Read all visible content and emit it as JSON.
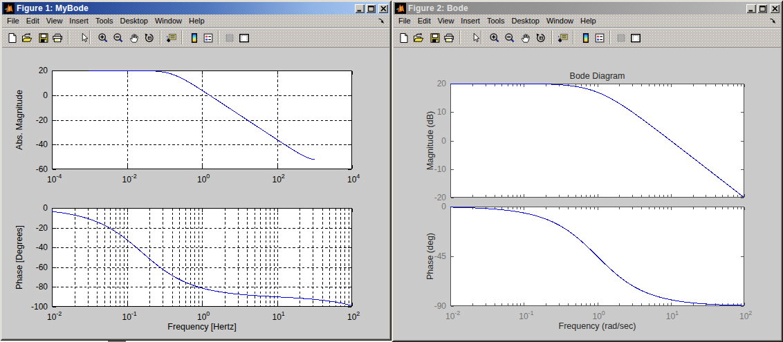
{
  "windows": [
    {
      "title": "Figure 1: MyBode",
      "state": "active",
      "menu": [
        "File",
        "Edit",
        "View",
        "Insert",
        "Tools",
        "Desktop",
        "Window",
        "Help"
      ],
      "toolbar": [
        "new-figure",
        "open-file",
        "save-figure",
        "print-figure",
        "edit-plot",
        "zoom-in",
        "zoom-out",
        "pan",
        "rotate-3d",
        "data-cursor",
        "insert-colorbar",
        "insert-legend",
        "hide-plot-tools",
        "show-plot-tools"
      ]
    },
    {
      "title": "Figure 2: Bode",
      "state": "inactive",
      "menu": [
        "File",
        "Edit",
        "View",
        "Insert",
        "Tools",
        "Desktop",
        "Window",
        "Help"
      ],
      "toolbar": [
        "new-figure",
        "open-file",
        "save-figure",
        "print-figure",
        "edit-plot",
        "zoom-in",
        "zoom-out",
        "pan",
        "rotate-3d",
        "data-cursor",
        "insert-colorbar",
        "insert-legend",
        "hide-plot-tools",
        "show-plot-tools"
      ]
    }
  ],
  "colors": {
    "curve": "#0000dd",
    "titlebar_active_start": "#0a246a",
    "titlebar_active_end": "#a6caf0",
    "titlebar_inactive_start": "#7f7f7f",
    "titlebar_inactive_end": "#c3c3c3",
    "chrome": "#c7c4bc",
    "figure_background": "#c9c9c9",
    "axes_black": "#000000",
    "axes_gray": "#4c4c4c",
    "tick_label_gray": "#757575"
  },
  "chart_data": [
    {
      "id": "fig1-magnitude",
      "type": "line",
      "figure": "Figure 1: MyBode",
      "xscale": "log",
      "xlim": [
        0.0001,
        10000.0
      ],
      "ylim": [
        -60,
        20
      ],
      "xtick_exponents": [
        -4,
        -2,
        0,
        2,
        4
      ],
      "yticks": [
        20,
        0,
        -20,
        -40,
        -60
      ],
      "xlabel": "",
      "ylabel": "Abs. Magnitude",
      "title": "",
      "grid": true,
      "x_minor_grid": false,
      "legend": null,
      "series": [
        {
          "name": "magnitude-db",
          "x": [
            0.001,
            0.00125893,
            0.00158489,
            0.00199526,
            0.00251189,
            0.00316228,
            0.00398107,
            0.00501187,
            0.00630957,
            0.00794328,
            0.01,
            0.0125893,
            0.0158489,
            0.0199526,
            0.0251189,
            0.0316228,
            0.0398107,
            0.0501187,
            0.0630957,
            0.0794328,
            0.1,
            0.125893,
            0.158489,
            0.199526,
            0.251189,
            0.316228,
            0.398107,
            0.501187,
            0.630957,
            0.794328,
            1.0,
            1.25893,
            1.58489,
            1.99526,
            2.51189,
            3.16228,
            3.98107,
            5.01187,
            6.30957,
            7.94328,
            10.0,
            12.5893,
            15.8489,
            19.9526,
            25.1189,
            31.6228,
            39.8107,
            50.1187,
            63.0957,
            79.4328,
            100.0,
            125.893,
            158.489,
            199.526,
            251.189,
            316.228,
            398.107,
            501.187,
            630.957,
            794.328,
            1000.0
          ],
          "y": [
            20.0,
            20.0,
            20.0,
            19.999,
            19.999,
            19.998,
            19.997,
            19.996,
            19.993,
            19.989,
            19.983,
            19.973,
            19.957,
            19.932,
            19.893,
            19.832,
            19.736,
            19.589,
            19.366,
            19.034,
            18.555,
            17.89,
            17.008,
            15.898,
            14.571,
            13.056,
            11.392,
            9.619,
            7.769,
            5.865,
            3.928,
            1.968,
            -0.007,
            -1.991,
            -3.981,
            -5.975,
            -7.97,
            -9.968,
            -11.966,
            -13.965,
            -15.964,
            -17.964,
            -19.963,
            -21.962,
            -23.962,
            -25.96,
            -27.958,
            -29.955,
            -31.949,
            -33.941,
            -35.928,
            -37.907,
            -39.874,
            -41.821,
            -43.737,
            -45.603,
            -47.39,
            -49.047,
            -50.492,
            -51.58,
            -52.041
          ]
        }
      ]
    },
    {
      "id": "fig1-phase",
      "type": "line",
      "figure": "Figure 1: MyBode",
      "xscale": "log",
      "xlim": [
        0.01,
        100.0
      ],
      "ylim": [
        -100,
        0
      ],
      "xtick_exponents": [
        -2,
        -1,
        0,
        1,
        2
      ],
      "yticks": [
        0,
        -20,
        -40,
        -60,
        -80,
        -100
      ],
      "xlabel": "Frequency [Hertz]",
      "ylabel": "Phase [Degrees]",
      "title": "",
      "grid": true,
      "x_minor_grid": true,
      "legend": null,
      "series": [
        {
          "name": "phase-degrees",
          "x": [
            0.01,
            0.0116591,
            0.0135936,
            0.0158489,
            0.0184785,
            0.0215443,
            0.0251189,
            0.0292864,
            0.0341455,
            0.0398107,
            0.0464159,
            0.054117,
            0.0630957,
            0.0735642,
            0.0857696,
            0.1,
            0.116591,
            0.135936,
            0.158489,
            0.184785,
            0.215443,
            0.251189,
            0.292864,
            0.341455,
            0.398107,
            0.464159,
            0.54117,
            0.630957,
            0.735642,
            0.857696,
            1.0,
            1.16591,
            1.35936,
            1.58489,
            1.84785,
            2.15443,
            2.51189,
            2.92864,
            3.41455,
            3.98107,
            4.64159,
            5.4117,
            6.30957,
            7.35642,
            8.57696,
            10.0,
            11.6591,
            13.5936,
            15.8489,
            18.4785,
            21.5443,
            25.1189,
            29.2864,
            34.1455,
            39.8107,
            46.4159,
            54.117,
            63.0957,
            73.5642,
            85.7696,
            100.0
          ],
          "y": [
            -3.596,
            -4.191,
            -4.883,
            -5.688,
            -6.624,
            -7.711,
            -8.971,
            -10.429,
            -12.112,
            -14.047,
            -16.263,
            -18.784,
            -21.631,
            -24.814,
            -28.328,
            -32.151,
            -36.236,
            -40.513,
            -44.894,
            -49.278,
            -53.565,
            -57.664,
            -61.505,
            -65.04,
            -68.245,
            -71.116,
            -73.66,
            -75.9,
            -77.859,
            -79.565,
            -81.047,
            -82.332,
            -83.445,
            -84.408,
            -85.244,
            -85.969,
            -86.601,
            -87.153,
            -87.639,
            -88.069,
            -88.454,
            -88.803,
            -89.123,
            -89.423,
            -89.709,
            -89.988,
            -90.267,
            -90.553,
            -90.851,
            -91.17,
            -91.516,
            -91.898,
            -92.325,
            -92.806,
            -93.354,
            -93.981,
            -94.702,
            -95.535,
            -96.497,
            -97.614,
            -98.91
          ]
        }
      ]
    },
    {
      "id": "fig2-magnitude",
      "type": "line",
      "figure": "Figure 2: Bode",
      "xscale": "log",
      "xlim": [
        0.01,
        100.0
      ],
      "ylim": [
        -20,
        20
      ],
      "xtick_exponents": [],
      "yticks": [
        20,
        10,
        0,
        -10,
        -20
      ],
      "xlabel": "",
      "ylabel": "Magnitude (dB)",
      "title": "Bode Diagram",
      "grid": false,
      "x_minor_grid": false,
      "legend": null,
      "xticks_all_decades": true,
      "series": [
        {
          "name": "magnitude-db",
          "x": [
            0.01,
            0.0116591,
            0.0135936,
            0.0158489,
            0.0184785,
            0.0215443,
            0.0251189,
            0.0292864,
            0.0341455,
            0.0398107,
            0.0464159,
            0.054117,
            0.0630957,
            0.0735642,
            0.0857696,
            0.1,
            0.116591,
            0.135936,
            0.158489,
            0.184785,
            0.215443,
            0.251189,
            0.292864,
            0.341455,
            0.398107,
            0.464159,
            0.54117,
            0.630957,
            0.735642,
            0.857696,
            1.0,
            1.16591,
            1.35936,
            1.58489,
            1.84785,
            2.15443,
            2.51189,
            2.92864,
            3.41455,
            3.98107,
            4.64159,
            5.4117,
            6.30957,
            7.35642,
            8.57696,
            10.0,
            11.6591,
            13.5936,
            15.8489,
            18.4785,
            21.5443,
            25.1189,
            29.2864,
            34.1455,
            39.8107,
            46.4159,
            54.117,
            63.0957,
            73.5642,
            85.7696,
            100.0
          ],
          "y": [
            20.0,
            19.999,
            19.999,
            19.999,
            19.999,
            19.998,
            19.997,
            19.996,
            19.995,
            19.993,
            19.991,
            19.987,
            19.983,
            19.977,
            19.968,
            19.957,
            19.941,
            19.92,
            19.892,
            19.854,
            19.803,
            19.734,
            19.643,
            19.521,
            19.361,
            19.153,
            18.884,
            18.545,
            18.121,
            17.605,
            16.99,
            16.272,
            15.455,
            14.545,
            13.551,
            12.486,
            11.361,
            10.188,
            8.976,
            7.734,
            6.47,
            5.188,
            3.892,
            2.587,
            1.275,
            -0.043,
            -1.365,
            -2.69,
            -4.017,
            -5.346,
            -6.676,
            -8.007,
            -9.338,
            -10.67,
            -12.003,
            -13.335,
            -14.668,
            -16.001,
            -17.334,
            -18.667,
            -20.0
          ]
        }
      ]
    },
    {
      "id": "fig2-phase",
      "type": "line",
      "figure": "Figure 2: Bode",
      "xscale": "log",
      "xlim": [
        0.01,
        100.0
      ],
      "ylim": [
        -90,
        0
      ],
      "xtick_exponents": [
        -2,
        -1,
        0,
        1,
        2
      ],
      "yticks": [
        0,
        -45,
        -90
      ],
      "xlabel": "Frequency  (rad/sec)",
      "ylabel": "Phase (deg)",
      "title": "",
      "grid": false,
      "x_minor_grid": false,
      "legend": null,
      "series": [
        {
          "name": "phase-degrees",
          "x": [
            0.01,
            0.0116591,
            0.0135936,
            0.0158489,
            0.0184785,
            0.0215443,
            0.0251189,
            0.0292864,
            0.0341455,
            0.0398107,
            0.0464159,
            0.054117,
            0.0630957,
            0.0735642,
            0.0857696,
            0.1,
            0.116591,
            0.135936,
            0.158489,
            0.184785,
            0.215443,
            0.251189,
            0.292864,
            0.341455,
            0.398107,
            0.464159,
            0.54117,
            0.630957,
            0.735642,
            0.857696,
            1.0,
            1.16591,
            1.35936,
            1.58489,
            1.84785,
            2.15443,
            2.51189,
            2.92864,
            3.41455,
            3.98107,
            4.64159,
            5.4117,
            6.30957,
            7.35642,
            8.57696,
            10.0,
            11.6591,
            13.5936,
            15.8489,
            18.4785,
            21.5443,
            25.1189,
            29.2864,
            34.1455,
            39.8107,
            46.4159,
            54.117,
            63.0957,
            73.5642,
            85.7696,
            100.0
          ],
          "y": [
            -0.573,
            -0.668,
            -0.779,
            -0.908,
            -1.059,
            -1.234,
            -1.439,
            -1.678,
            -1.956,
            -2.28,
            -2.658,
            -3.098,
            -3.61,
            -4.207,
            -4.902,
            -5.711,
            -6.65,
            -7.741,
            -9.006,
            -10.469,
            -12.158,
            -14.1,
            -16.323,
            -18.853,
            -21.708,
            -24.899,
            -28.421,
            -32.25,
            -36.34,
            -40.62,
            -45.0,
            -49.38,
            -53.66,
            -57.75,
            -61.579,
            -65.101,
            -68.292,
            -71.147,
            -73.677,
            -75.9,
            -77.842,
            -79.531,
            -80.994,
            -82.259,
            -83.35,
            -84.289,
            -85.098,
            -85.793,
            -86.39,
            -86.902,
            -87.342,
            -87.72,
            -88.044,
            -88.322,
            -88.561,
            -88.766,
            -88.941,
            -89.092,
            -89.221,
            -89.332,
            -89.427
          ]
        }
      ]
    }
  ]
}
